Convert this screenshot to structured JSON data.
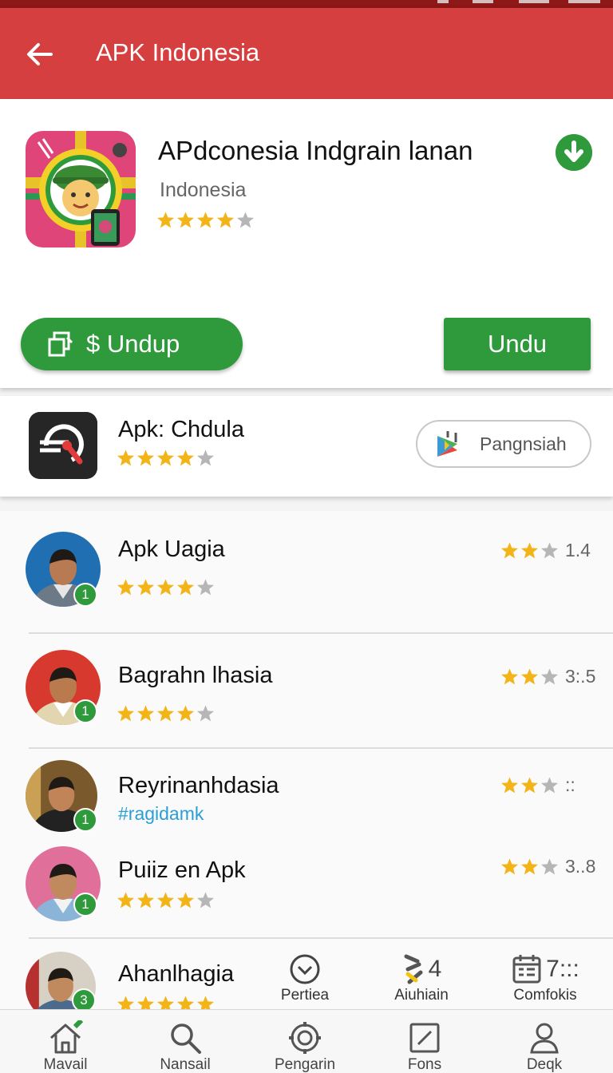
{
  "app_bar": {
    "title": "APK Indonesia"
  },
  "featured": {
    "title": "APdconesia Indgrain lanan",
    "subtitle": "Indonesia",
    "rating_stars": 4,
    "primary_button_label": "$ Undup",
    "secondary_button_label": "Undu",
    "accent_color": "#2f9a3b"
  },
  "second_app": {
    "title": "Apk: Chdula",
    "rating_stars": 4,
    "button_label": "Pangnsiah"
  },
  "list": [
    {
      "name": "Apk Uagia",
      "stars": 4,
      "rank": "1",
      "score_stars": 2,
      "score": "1.4"
    },
    {
      "name": "Bagrahn lhasia",
      "stars": 4,
      "rank": "1",
      "score_stars": 2,
      "score": "3:.5"
    },
    {
      "name": "Reyrinanhdasia",
      "tag": "#ragidamk",
      "rank": "1",
      "score_stars": 2,
      "score": "::"
    },
    {
      "name": "Puiiz en Apk",
      "stars": 4,
      "rank": "1",
      "score_stars": 2,
      "score": "3..8"
    },
    {
      "name": "Ahanlhagia",
      "stars": 5,
      "rank": "3"
    }
  ],
  "quick_actions": [
    {
      "icon": "check-circle-icon",
      "label": "Pertiea"
    },
    {
      "icon": "tools-icon",
      "label": "Aiuhiain",
      "value": "4"
    },
    {
      "icon": "calendar-icon",
      "label": "Comfokis",
      "value": "7:::"
    }
  ],
  "bottom_nav": [
    {
      "icon": "home-icon",
      "label": "Mavail"
    },
    {
      "icon": "search-icon",
      "label": "Nansail"
    },
    {
      "icon": "settings-icon",
      "label": "Pengarin"
    },
    {
      "icon": "edit-icon",
      "label": "Fons"
    },
    {
      "icon": "person-icon",
      "label": "Deqk"
    }
  ]
}
